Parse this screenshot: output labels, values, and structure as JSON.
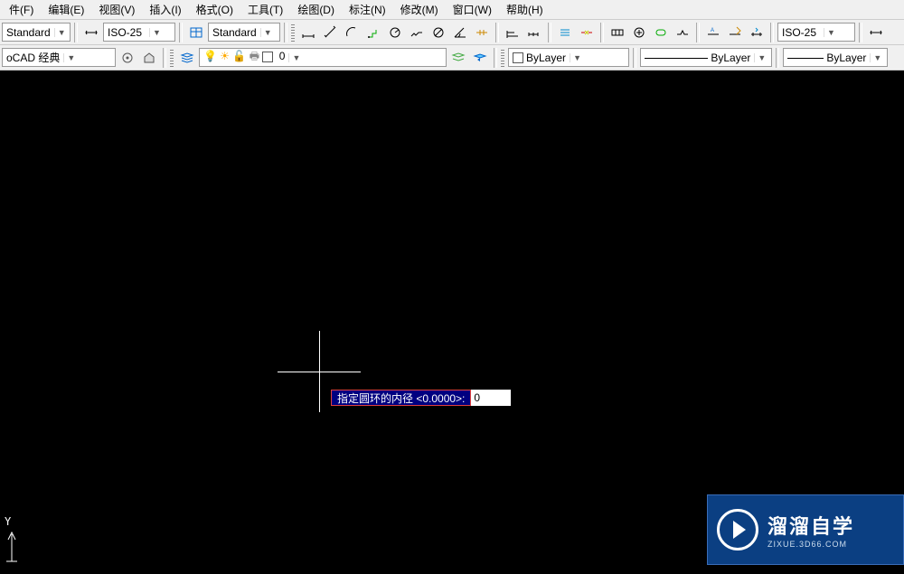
{
  "menubar": {
    "items": [
      {
        "label": "件(F)"
      },
      {
        "label": "编辑(E)"
      },
      {
        "label": "视图(V)"
      },
      {
        "label": "插入(I)"
      },
      {
        "label": "格式(O)"
      },
      {
        "label": "工具(T)"
      },
      {
        "label": "绘图(D)"
      },
      {
        "label": "标注(N)"
      },
      {
        "label": "修改(M)"
      },
      {
        "label": "窗口(W)"
      },
      {
        "label": "帮助(H)"
      }
    ]
  },
  "toolbar1": {
    "style_combo1": "Standard",
    "style_combo2": "ISO-25",
    "style_combo3": "Standard",
    "style_combo4": "ISO-25"
  },
  "toolbar2": {
    "workspace": "oCAD 经典",
    "layer_name": "0",
    "bylayer1": "ByLayer",
    "bylayer2": "ByLayer",
    "bylayer3": "ByLayer"
  },
  "dynamic_input": {
    "prompt": "指定圆环的内径 <0.0000>:",
    "value": "0"
  },
  "ucs": {
    "y": "Y"
  },
  "watermark": {
    "title": "溜溜自学",
    "sub": "ZIXUE.3D66.COM"
  }
}
